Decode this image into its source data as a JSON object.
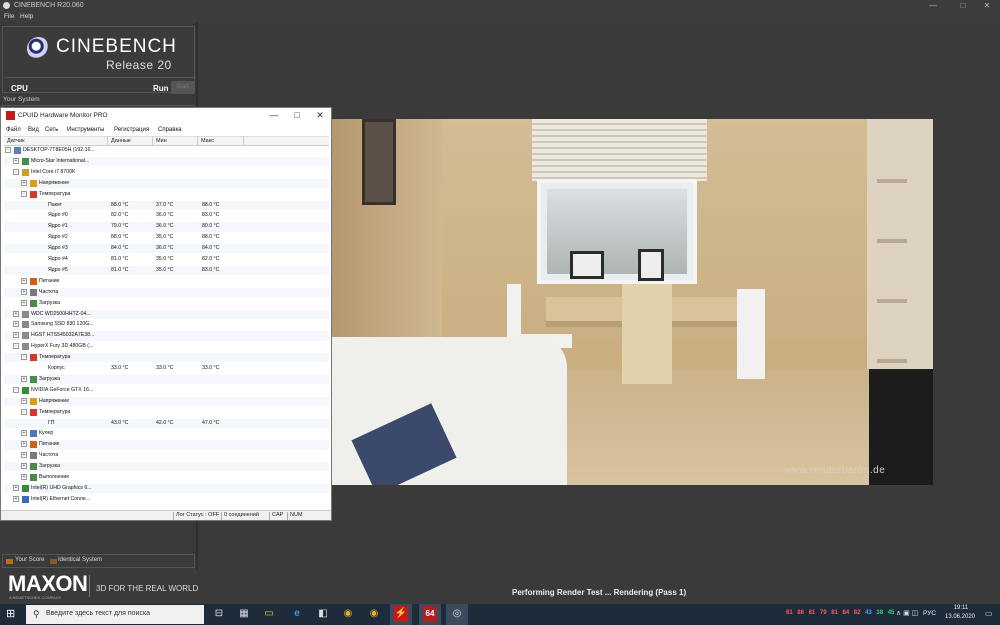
{
  "window": {
    "title": "CINEBENCH R20.060",
    "controls": [
      "—",
      "□",
      "✕"
    ]
  },
  "menu": [
    "File",
    "Help"
  ],
  "logo": {
    "name": "CINEBENCH",
    "release": "Release 20"
  },
  "benchmark": {
    "cpu_label": "CPU",
    "run_label": "Run",
    "run_button": "Start"
  },
  "your_system": "Your System",
  "legend": {
    "your_score": "Your Score",
    "identical_system": "Identical System",
    "your_score_color": "#c06a1c",
    "identical_color": "#8a5a2a"
  },
  "footer": {
    "maxon": "MAXON",
    "maxon_sub": "A NEMETSCHEK COMPANY",
    "tagline": "3D FOR THE REAL WORLD",
    "status": "Performing Render Test ... Rendering (Pass 1)"
  },
  "render": {
    "watermark": "www.renderbaron.de"
  },
  "hwmonitor": {
    "title": "CPUID Hardware Monitor PRO",
    "controls": [
      "—",
      "□",
      "✕"
    ],
    "menu": [
      "Файл",
      "Вид",
      "Сеть",
      "Инструменты",
      "Регистрация",
      "Справка"
    ],
    "columns": [
      "Датчик",
      "Данные",
      "Мин",
      "Макс"
    ],
    "rows": [
      {
        "level": 0,
        "exp": "-",
        "icon": "computer-icon",
        "label": "DESKTOP-7T8E05H (192.16...",
        "data": "",
        "min": "",
        "max": ""
      },
      {
        "level": 1,
        "exp": "+",
        "icon": "motherboard-icon",
        "label": "Micro-Star International...",
        "data": "",
        "min": "",
        "max": ""
      },
      {
        "level": 1,
        "exp": "-",
        "icon": "cpu-icon",
        "label": "Intel Core i7 8700K",
        "data": "",
        "min": "",
        "max": ""
      },
      {
        "level": 2,
        "exp": "+",
        "icon": "voltage-icon",
        "label": "Напряжение",
        "data": "",
        "min": "",
        "max": ""
      },
      {
        "level": 2,
        "exp": "-",
        "icon": "temperature-icon",
        "label": "Температура",
        "data": "",
        "min": "",
        "max": ""
      },
      {
        "level": 3,
        "exp": "",
        "icon": "",
        "label": "Пакет",
        "data": "88.0 °C",
        "min": "37.0 °C",
        "max": "88.0 °C"
      },
      {
        "level": 3,
        "exp": "",
        "icon": "",
        "label": "Ядро #0",
        "data": "82.0 °C",
        "min": "36.0 °C",
        "max": "83.0 °C"
      },
      {
        "level": 3,
        "exp": "",
        "icon": "",
        "label": "Ядро #1",
        "data": "79.0 °C",
        "min": "36.0 °C",
        "max": "80.0 °C"
      },
      {
        "level": 3,
        "exp": "",
        "icon": "",
        "label": "Ядро #2",
        "data": "88.0 °C",
        "min": "35.0 °C",
        "max": "88.0 °C"
      },
      {
        "level": 3,
        "exp": "",
        "icon": "",
        "label": "Ядро #3",
        "data": "84.0 °C",
        "min": "36.0 °C",
        "max": "84.0 °C"
      },
      {
        "level": 3,
        "exp": "",
        "icon": "",
        "label": "Ядро #4",
        "data": "81.0 °C",
        "min": "35.0 °C",
        "max": "82.0 °C"
      },
      {
        "level": 3,
        "exp": "",
        "icon": "",
        "label": "Ядро #5",
        "data": "81.0 °C",
        "min": "35.0 °C",
        "max": "83.0 °C"
      },
      {
        "level": 2,
        "exp": "+",
        "icon": "power-icon",
        "label": "Питание",
        "data": "",
        "min": "",
        "max": ""
      },
      {
        "level": 2,
        "exp": "+",
        "icon": "clock-icon",
        "label": "Частота",
        "data": "",
        "min": "",
        "max": ""
      },
      {
        "level": 2,
        "exp": "+",
        "icon": "load-icon",
        "label": "Загрузка",
        "data": "",
        "min": "",
        "max": ""
      },
      {
        "level": 1,
        "exp": "+",
        "icon": "hdd-icon",
        "label": "WDC WD2500HHTZ-04...",
        "data": "",
        "min": "",
        "max": ""
      },
      {
        "level": 1,
        "exp": "+",
        "icon": "hdd-icon",
        "label": "Samsung SSD 830 120G...",
        "data": "",
        "min": "",
        "max": ""
      },
      {
        "level": 1,
        "exp": "+",
        "icon": "hdd-icon",
        "label": "HGST HTS545032A7E38...",
        "data": "",
        "min": "",
        "max": ""
      },
      {
        "level": 1,
        "exp": "-",
        "icon": "hdd-icon",
        "label": "HyperX Fury 3D 480GB (...",
        "data": "",
        "min": "",
        "max": ""
      },
      {
        "level": 2,
        "exp": "-",
        "icon": "temperature-icon",
        "label": "Температура",
        "data": "",
        "min": "",
        "max": ""
      },
      {
        "level": 3,
        "exp": "",
        "icon": "",
        "label": "Корпус",
        "data": "33.0 °C",
        "min": "33.0 °C",
        "max": "33.0 °C"
      },
      {
        "level": 2,
        "exp": "+",
        "icon": "load-icon",
        "label": "Загрузка",
        "data": "",
        "min": "",
        "max": ""
      },
      {
        "level": 1,
        "exp": "-",
        "icon": "gpu-icon",
        "label": "NVIDIA GeForce GTX 16...",
        "data": "",
        "min": "",
        "max": ""
      },
      {
        "level": 2,
        "exp": "+",
        "icon": "voltage-icon",
        "label": "Напряжение",
        "data": "",
        "min": "",
        "max": ""
      },
      {
        "level": 2,
        "exp": "-",
        "icon": "temperature-icon",
        "label": "Температура",
        "data": "",
        "min": "",
        "max": ""
      },
      {
        "level": 3,
        "exp": "",
        "icon": "",
        "label": "ГП",
        "data": "43.0 °C",
        "min": "42.0 °C",
        "max": "47.0 °C"
      },
      {
        "level": 2,
        "exp": "+",
        "icon": "fan-icon",
        "label": "Кулер",
        "data": "",
        "min": "",
        "max": ""
      },
      {
        "level": 2,
        "exp": "+",
        "icon": "power-icon",
        "label": "Питание",
        "data": "",
        "min": "",
        "max": ""
      },
      {
        "level": 2,
        "exp": "+",
        "icon": "clock-icon",
        "label": "Частота",
        "data": "",
        "min": "",
        "max": ""
      },
      {
        "level": 2,
        "exp": "+",
        "icon": "load-icon",
        "label": "Загрузка",
        "data": "",
        "min": "",
        "max": ""
      },
      {
        "level": 2,
        "exp": "+",
        "icon": "load-icon",
        "label": "Выполнение",
        "data": "",
        "min": "",
        "max": ""
      },
      {
        "level": 1,
        "exp": "+",
        "icon": "gpu-icon",
        "label": "Intel(R) UHD Graphics 6...",
        "data": "",
        "min": "",
        "max": ""
      },
      {
        "level": 1,
        "exp": "+",
        "icon": "network-icon",
        "label": "Intel(R) Ethernet Conne...",
        "data": "",
        "min": "",
        "max": ""
      }
    ],
    "status": {
      "log": "Лог Статус : OFF",
      "connections": "0 соединений",
      "caps": "CAP",
      "num": "NUM"
    }
  },
  "taskbar": {
    "search_placeholder": "Введите здесь текст для поиска",
    "tray_values": [
      "61",
      "86",
      "81",
      "79",
      "81",
      "84",
      "82",
      "43",
      "38",
      "45"
    ],
    "tray_colors": [
      "#ff5a5a",
      "#ff5a5a",
      "#ff5a5a",
      "#ff5a5a",
      "#ff5a5a",
      "#ff5a5a",
      "#ff5a5a",
      "#4aa3ff",
      "#39d36a",
      "#39d36a"
    ],
    "lang": "РУС",
    "time": "19:11",
    "date": "13.06.2020",
    "pinned": [
      "task-view-icon",
      "calculator-icon",
      "explorer-icon",
      "edge-icon",
      "store-icon",
      "chrome-icon",
      "chrome-alt-icon",
      "hwmonitor-icon",
      "aida64-icon",
      "cinebench-icon"
    ],
    "pinned_glyphs": [
      "⊟",
      "▦",
      "▭",
      "e",
      "◧",
      "◉",
      "◉",
      "⚡",
      "64",
      "◎"
    ]
  }
}
